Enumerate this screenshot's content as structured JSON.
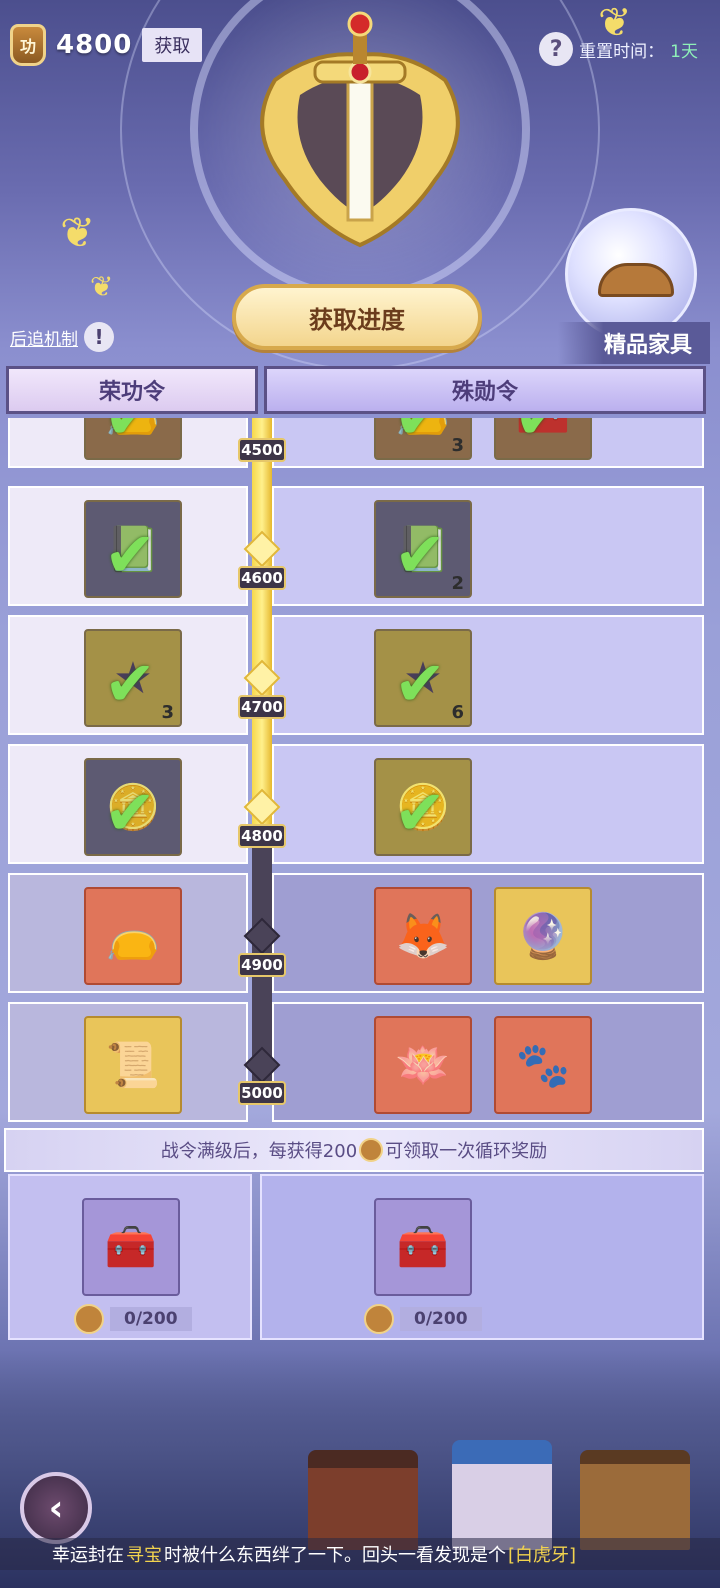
{
  "header": {
    "badge_icon": "gong-medal-icon",
    "badge_char": "功",
    "score": "4800",
    "get_button": "获取",
    "reset_label": "重置时间：",
    "reset_value": "1天"
  },
  "hero": {
    "progress_button": "获取进度",
    "catchup_label": "后追机制",
    "premium_label": "精品家具"
  },
  "tracks": {
    "left_title": "荣功令",
    "right_title": "殊勋令"
  },
  "levels": [
    {
      "value": "4500",
      "reached": true,
      "free": {
        "icon": "pouch-icon",
        "claimed": true,
        "count": ""
      },
      "paid": [
        {
          "icon": "pouch-icon",
          "claimed": true,
          "count": "3"
        },
        {
          "icon": "chest-icon",
          "claimed": true,
          "count": ""
        }
      ]
    },
    {
      "value": "4600",
      "reached": true,
      "free": {
        "icon": "book-icon",
        "claimed": true,
        "count": ""
      },
      "paid": [
        {
          "icon": "book-icon",
          "claimed": true,
          "count": "2"
        }
      ]
    },
    {
      "value": "4700",
      "reached": true,
      "free": {
        "icon": "star-icon",
        "claimed": true,
        "count": "3"
      },
      "paid": [
        {
          "icon": "star-icon",
          "claimed": true,
          "count": "6"
        }
      ]
    },
    {
      "value": "4800",
      "reached": true,
      "free": {
        "icon": "coin-stack-icon",
        "claimed": true,
        "count": ""
      },
      "paid": [
        {
          "icon": "coin-stack-icon",
          "claimed": true,
          "count": ""
        }
      ]
    },
    {
      "value": "4900",
      "reached": false,
      "free": {
        "icon": "pouch-icon",
        "claimed": false,
        "count": ""
      },
      "paid": [
        {
          "icon": "fox-orb-icon",
          "claimed": false,
          "count": ""
        },
        {
          "icon": "crystal-ball-icon",
          "claimed": false,
          "count": ""
        }
      ]
    },
    {
      "value": "5000",
      "reached": false,
      "free": {
        "icon": "scroll-icon",
        "claimed": false,
        "count": ""
      },
      "paid": [
        {
          "icon": "lotus-pendant-icon",
          "claimed": false,
          "count": ""
        },
        {
          "icon": "paw-orb-icon",
          "claimed": false,
          "count": ""
        }
      ]
    }
  ],
  "loop": {
    "banner_before": "战令满级后，每获得200",
    "banner_after": "可领取一次循环奖励",
    "free_progress": "0/200",
    "paid_progress": "0/200"
  },
  "ticker": {
    "part1": "幸运封在",
    "kw1": "寻宝",
    "part2": "时被什么东西绊了一下。回头一看发现是个",
    "kw2": "[白虎牙]"
  },
  "colors": {
    "accent_gold": "#f3d58d",
    "claimed_green": "#7ee05a",
    "highlight_yellow": "#f2d34e"
  }
}
